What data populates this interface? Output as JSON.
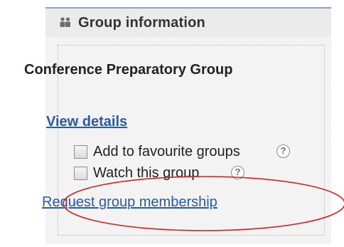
{
  "panel": {
    "header_icon": "group-icon",
    "title": "Group information"
  },
  "group": {
    "name": "Conference Preparatory Group"
  },
  "actions": {
    "view_details": "View details",
    "add_favourite": "Add to favourite groups",
    "watch_group": "Watch this group",
    "help_glyph": "?",
    "request_membership": "Request group membership"
  },
  "colors": {
    "link": "#2a5aa6",
    "panel_background": "#f3f3f3",
    "header_border": "#8aa4c8",
    "annotation_ellipse": "#d61f1f"
  }
}
